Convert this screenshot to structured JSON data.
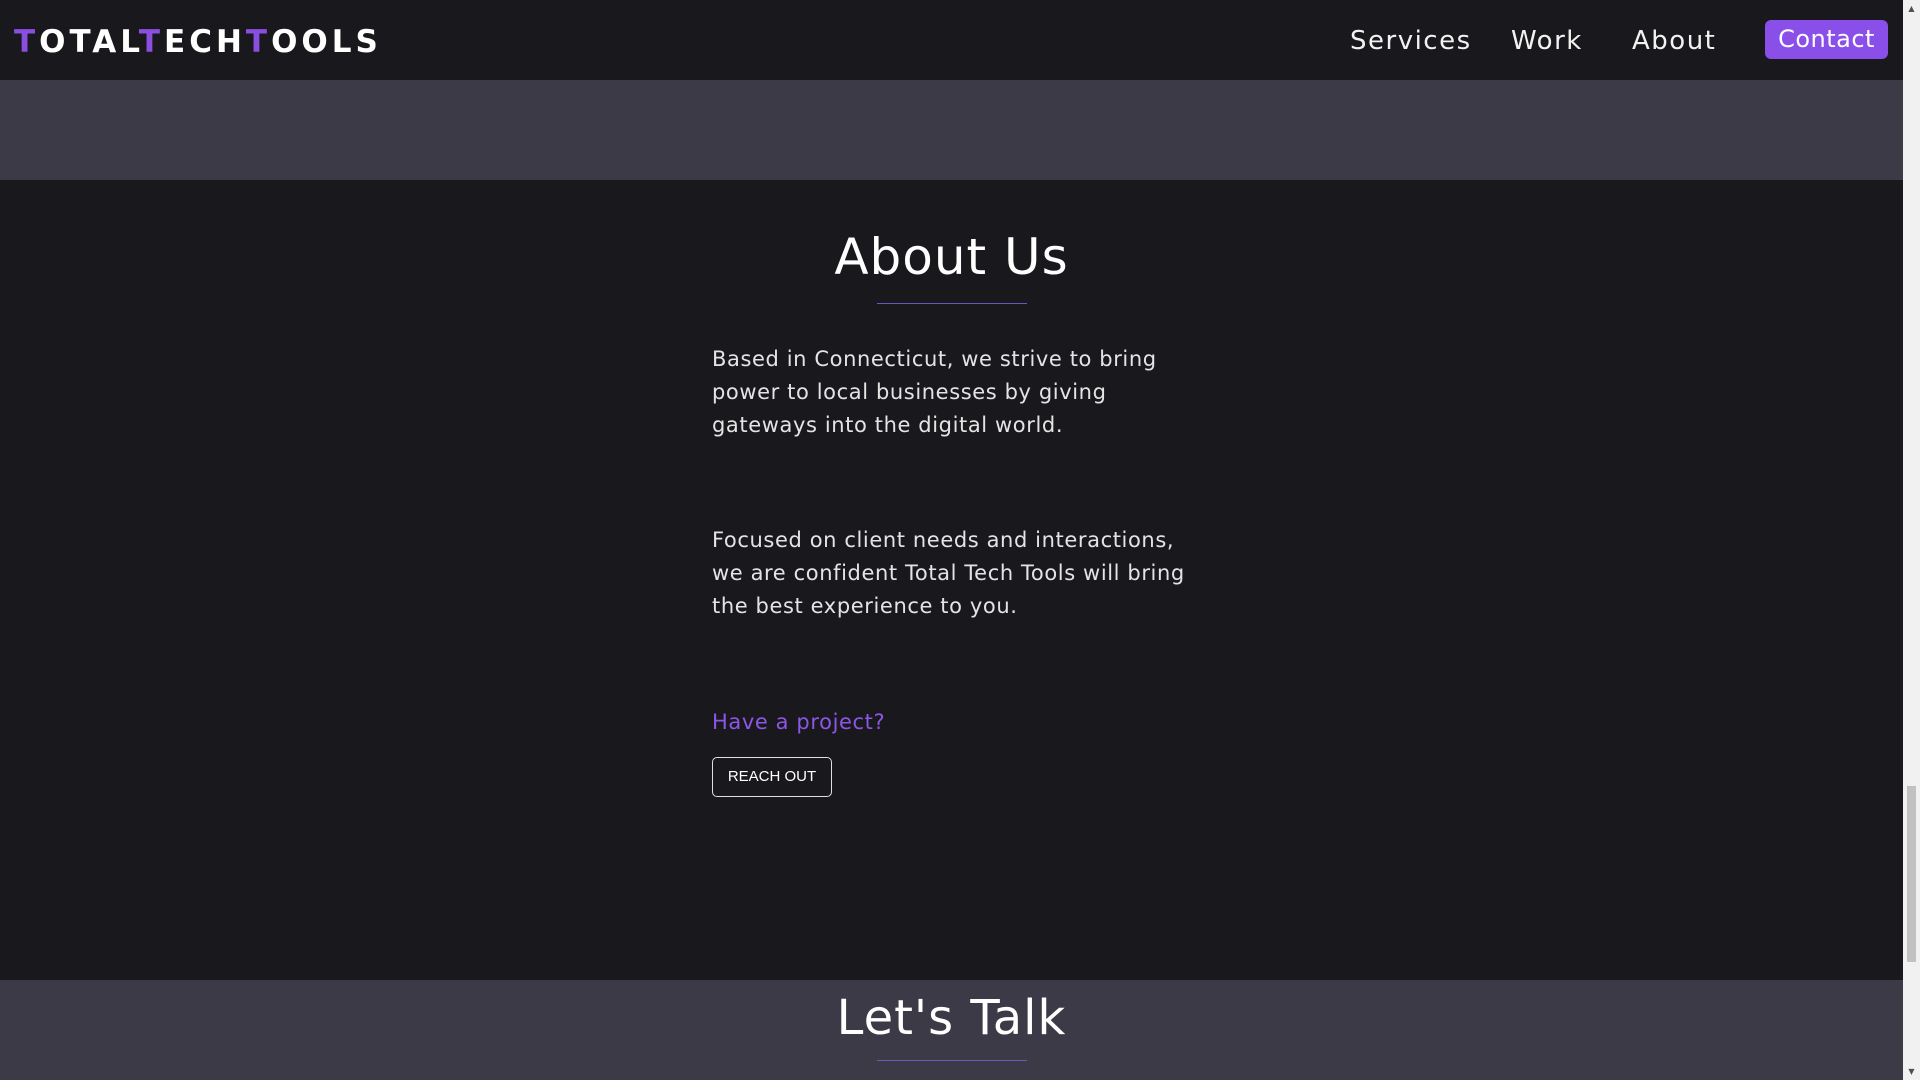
{
  "nav": {
    "logo": {
      "parts": [
        {
          "text": "T",
          "accent": true
        },
        {
          "text": "OTAL",
          "accent": false
        },
        {
          "text": "T",
          "accent": true
        },
        {
          "text": "ECH",
          "accent": false
        },
        {
          "text": "T",
          "accent": true
        },
        {
          "text": "OOLS",
          "accent": false
        }
      ]
    },
    "links": [
      "Services",
      "Work",
      "About"
    ],
    "contact_label": "Contact"
  },
  "about": {
    "title": "About Us",
    "paragraph_1": "Based in Connecticut, we strive to bring power to local businesses by giving gateways into the digital world.",
    "paragraph_2": "Focused on client needs and interactions, we are confident Total Tech Tools will bring the best experience to you.",
    "cta_prompt": "Have a project?",
    "cta_button": "REACH OUT"
  },
  "talk": {
    "title": "Let's Talk"
  },
  "scrollbar": {
    "up_arrow": "▲",
    "down_arrow": "▼"
  },
  "colors": {
    "accent": "#8a4fe8",
    "band": "#3d3a47",
    "background": "#19181c"
  }
}
